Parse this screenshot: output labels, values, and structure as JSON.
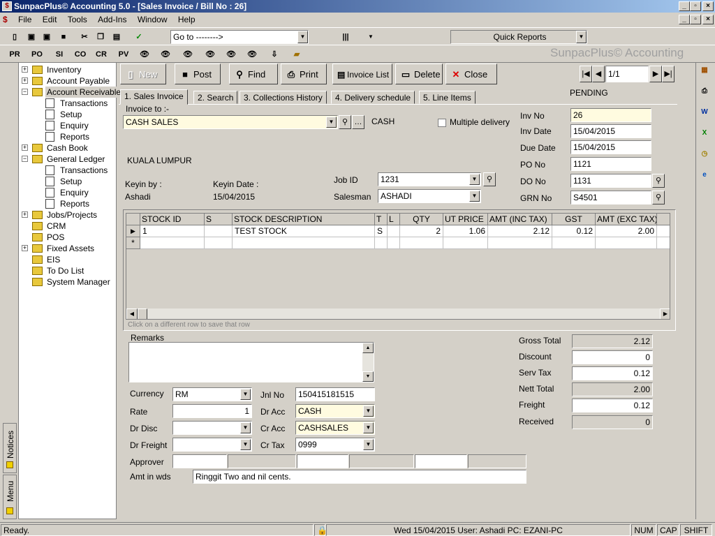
{
  "window": {
    "title": "SunpacPlus© Accounting 5.0 - [Sales Invoice / Bill No : 26]"
  },
  "menu": [
    "File",
    "Edit",
    "Tools",
    "Add-Ins",
    "Window",
    "Help"
  ],
  "toolbar1": {
    "goto_value": "Go to -------->",
    "quick_reports": "Quick Reports"
  },
  "toolbar2": {
    "buttons": [
      "PR",
      "PO",
      "SI",
      "CO",
      "CR",
      "PV"
    ]
  },
  "brand": "SunpacPlus© Accounting",
  "tree": [
    {
      "label": "Inventory",
      "expander": "+"
    },
    {
      "label": "Account Payable",
      "expander": "+"
    },
    {
      "label": "Account Receivable",
      "expander": "−"
    },
    {
      "label": "Transactions"
    },
    {
      "label": "Setup"
    },
    {
      "label": "Enquiry"
    },
    {
      "label": "Reports"
    },
    {
      "label": "Cash Book",
      "expander": "+"
    },
    {
      "label": "General Ledger",
      "expander": "−"
    },
    {
      "label": "Transactions"
    },
    {
      "label": "Setup"
    },
    {
      "label": "Enquiry"
    },
    {
      "label": "Reports"
    },
    {
      "label": "Jobs/Projects",
      "expander": "+"
    },
    {
      "label": "CRM"
    },
    {
      "label": "POS"
    },
    {
      "label": "Fixed Assets",
      "expander": "+"
    },
    {
      "label": "EIS"
    },
    {
      "label": "To Do List"
    },
    {
      "label": "System Manager"
    }
  ],
  "sidetabs": {
    "notices": "Notices",
    "menu": "Menu"
  },
  "actions": {
    "new": "New",
    "post": "Post",
    "find": "Find",
    "print": "Print",
    "invoice_list": "Invoice List",
    "delete": "Delete",
    "close": "Close"
  },
  "nav": {
    "record": "1/1"
  },
  "status_label": "PENDING",
  "tabs": [
    "1. Sales Invoice",
    "2. Search",
    "3. Collections History",
    "4. Delivery schedule",
    "5. Line Items"
  ],
  "invoice": {
    "invoice_to_label": "Invoice to :-",
    "customer": "CASH SALES",
    "customer_code": "CASH",
    "multiple_delivery": "Multiple delivery",
    "address": "KUALA LUMPUR",
    "keyin_by_label": "Keyin by :",
    "keyin_by": "Ashadi",
    "keyin_date_label": "Keyin Date :",
    "keyin_date": "15/04/2015",
    "job_id_label": "Job ID",
    "job_id": "1231",
    "salesman_label": "Salesman",
    "salesman": "ASHADI",
    "inv_no_label": "Inv No",
    "inv_no": "26",
    "inv_date_label": "Inv Date",
    "inv_date": "15/04/2015",
    "due_date_label": "Due Date",
    "due_date": "15/04/2015",
    "po_no_label": "PO No",
    "po_no": "1121",
    "do_no_label": "DO No",
    "do_no": "1131",
    "grn_no_label": "GRN No",
    "grn_no": "S4501"
  },
  "grid": {
    "columns": [
      "STOCK ID",
      "S",
      "STOCK DESCRIPTION",
      "T",
      "L",
      "QTY",
      "UT PRICE",
      "AMT (INC TAX)",
      "GST",
      "AMT (EXC TAX)"
    ],
    "rows": [
      [
        "1",
        "",
        "TEST STOCK",
        "S",
        "",
        "2",
        "1.06",
        "2.12",
        "0.12",
        "2.00"
      ]
    ],
    "new_row_marker": "*",
    "hint": "Click on a different row to save that row"
  },
  "remarks_label": "Remarks",
  "footer": {
    "currency_label": "Currency",
    "currency": "RM",
    "rate_label": "Rate",
    "rate": "1",
    "dr_disc_label": "Dr Disc",
    "dr_disc": "",
    "dr_freight_label": "Dr Freight",
    "dr_freight": "",
    "jnl_no_label": "Jnl No",
    "jnl_no": "150415181515",
    "dr_acc_label": "Dr Acc",
    "dr_acc": "CASH",
    "cr_acc_label": "Cr Acc",
    "cr_acc": "CASHSALES",
    "cr_tax_label": "Cr Tax",
    "cr_tax": "0999",
    "approver_label": "Approver",
    "amt_in_words_label": "Amt in wds",
    "amt_in_words": "Ringgit Two  and nil cents."
  },
  "totals": {
    "gross_total_label": "Gross Total",
    "gross_total": "2.12",
    "discount_label": "Discount",
    "discount": "0",
    "serv_tax_label": "Serv Tax",
    "serv_tax": "0.12",
    "nett_total_label": "Nett Total",
    "nett_total": "2.00",
    "freight_label": "Freight",
    "freight": "0.12",
    "received_label": "Received",
    "received": "0"
  },
  "statusbar": {
    "left": "Ready.",
    "info": "Wed 15/04/2015 User: Ashadi PC: EZANI-PC",
    "num": "NUM",
    "cap": "CAP",
    "shift": "SHIFT"
  }
}
